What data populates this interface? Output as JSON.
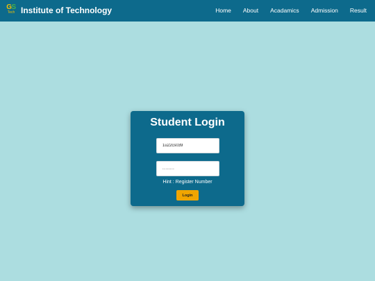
{
  "navbar": {
    "logo": {
      "letter_g": "G",
      "letter_s": "S",
      "sub": "Tech"
    },
    "brand": "Institute of Technology",
    "links": [
      {
        "label": "Home"
      },
      {
        "label": "About"
      },
      {
        "label": "Acadamics"
      },
      {
        "label": "Admission"
      },
      {
        "label": "Result"
      }
    ]
  },
  "login": {
    "title": "Student Login",
    "username_value": "1u22cs039",
    "password_value": "........",
    "hint": "Hint : Register Number",
    "button_label": "Login"
  },
  "colors": {
    "background": "#acdde0",
    "primary": "#0d6a8c",
    "accent_button": "#f0a500",
    "logo_yellow": "#f2c200",
    "logo_green": "#46b04a"
  }
}
